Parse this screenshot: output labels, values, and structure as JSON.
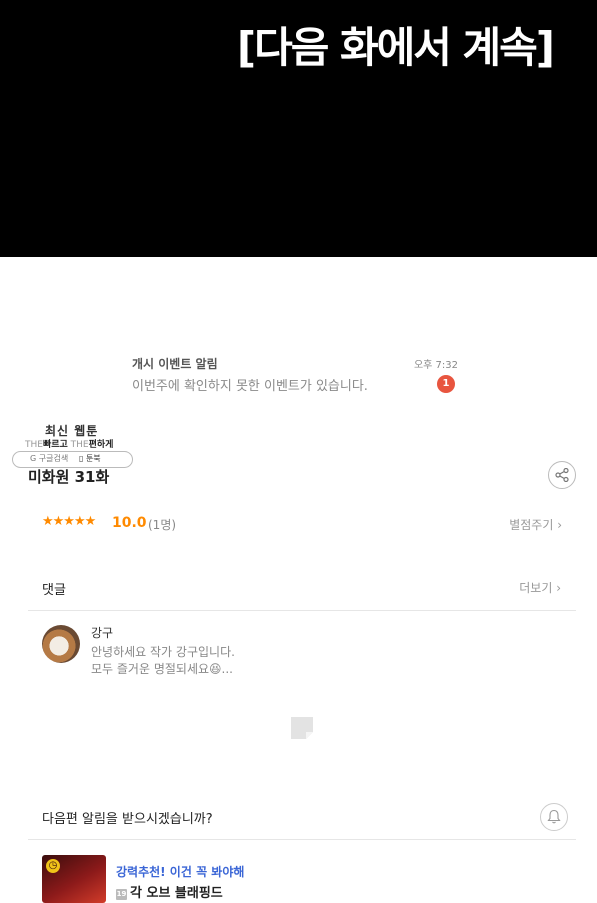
{
  "banner": {
    "text": "[다음 화에서 계속]"
  },
  "notification": {
    "title": "개시 이벤트 알림",
    "time": "오후 7:32",
    "body": "이번주에 확인하지 못한 이벤트가 있습니다.",
    "badge": "1"
  },
  "watermark": {
    "title": "최신 웹툰",
    "sub_light_1": "THE",
    "sub_bold_1": "빠르고",
    "sub_light_2": "THE",
    "sub_bold_2": "편하게",
    "google": "G 구글검색",
    "toonbook": "▯ 툰북"
  },
  "episode": {
    "title": "미화원 31화"
  },
  "rating": {
    "stars": "★★★★★",
    "score": "10.0",
    "count": "(1명)",
    "rate_link": "별점주기 ›"
  },
  "comments": {
    "label": "댓글",
    "more": "더보기 ›",
    "author": "강구",
    "line1": "안녕하세요 작가 강구입니다.",
    "line2": "모두 즐거운 명절되세요😆..."
  },
  "subscribe": {
    "label": "다음편 알림을 받으시겠습니까?"
  },
  "promo": {
    "title": "강력추천! 이건 꼭 봐야해",
    "tag": "19",
    "subtitle": "각 오브 블래핑드"
  },
  "colors": {
    "accent": "#ff8a00",
    "link_blue": "#3b66d6",
    "badge": "#e8553f"
  }
}
